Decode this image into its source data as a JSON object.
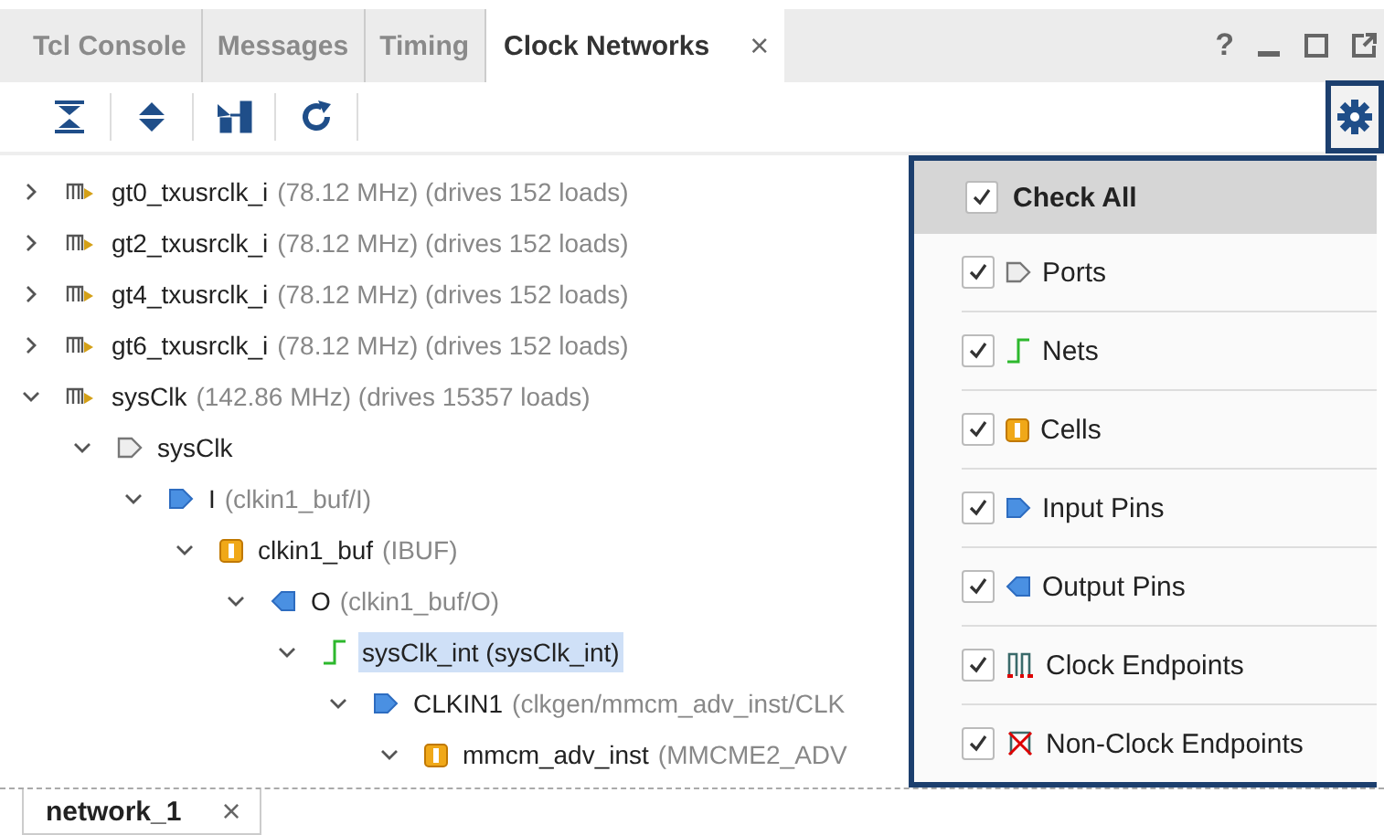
{
  "tabs": [
    {
      "label": "Tcl Console",
      "selected": false
    },
    {
      "label": "Messages",
      "selected": false
    },
    {
      "label": "Timing",
      "selected": false
    },
    {
      "label": "Clock Networks",
      "selected": true,
      "close": "×"
    }
  ],
  "window_controls": [
    "?"
  ],
  "tree": [
    {
      "kind": "clock",
      "name": "gt0_txusrclk_i",
      "detail": "(78.12 MHz) (drives 152 loads)",
      "expanded": false,
      "selected": false
    },
    {
      "kind": "clock",
      "name": "gt2_txusrclk_i",
      "detail": "(78.12 MHz) (drives 152 loads)",
      "expanded": false,
      "selected": false
    },
    {
      "kind": "clock",
      "name": "gt4_txusrclk_i",
      "detail": "(78.12 MHz) (drives 152 loads)",
      "expanded": false,
      "selected": false
    },
    {
      "kind": "clock",
      "name": "gt6_txusrclk_i",
      "detail": "(78.12 MHz) (drives 152 loads)",
      "expanded": false,
      "selected": false
    },
    {
      "kind": "clock",
      "name": "sysClk",
      "detail": "(142.86 MHz) (drives 15357 loads)",
      "expanded": true,
      "selected": false,
      "children": [
        {
          "kind": "port",
          "name": "sysClk",
          "expanded": true,
          "selected": false,
          "children": [
            {
              "kind": "input_pin",
              "name": "I",
              "detail": "(clkin1_buf/I)",
              "expanded": true,
              "selected": false,
              "children": [
                {
                  "kind": "cell",
                  "name": "clkin1_buf",
                  "detail": "(IBUF)",
                  "expanded": true,
                  "selected": false,
                  "children": [
                    {
                      "kind": "output_pin",
                      "name": "O",
                      "detail": "(clkin1_buf/O)",
                      "expanded": true,
                      "selected": false,
                      "children": [
                        {
                          "kind": "net",
                          "name": "sysClk_int (sysClk_int)",
                          "expanded": true,
                          "selected": true,
                          "children": [
                            {
                              "kind": "input_pin",
                              "name": "CLKIN1",
                              "detail": "(clkgen/mmcm_adv_inst/CLK",
                              "expanded": true,
                              "selected": false,
                              "children": [
                                {
                                  "kind": "cell",
                                  "name": "mmcm_adv_inst",
                                  "detail": "(MMCME2_ADV",
                                  "expanded": true,
                                  "selected": false
                                }
                              ]
                            }
                          ]
                        }
                      ]
                    }
                  ]
                }
              ]
            }
          ]
        }
      ]
    }
  ],
  "filter_menu": {
    "check_all": {
      "label": "Check All",
      "checked": true
    },
    "items": [
      {
        "kind": "port",
        "label": "Ports",
        "checked": true
      },
      {
        "kind": "net",
        "label": "Nets",
        "checked": true
      },
      {
        "kind": "cell",
        "label": "Cells",
        "checked": true
      },
      {
        "kind": "input_pin",
        "label": "Input Pins",
        "checked": true
      },
      {
        "kind": "output_pin",
        "label": "Output Pins",
        "checked": true
      },
      {
        "kind": "clock_endpoint",
        "label": "Clock Endpoints",
        "checked": true
      },
      {
        "kind": "nonclock_endpoint",
        "label": "Non-Clock Endpoints",
        "checked": true
      }
    ]
  },
  "bottom_tabs": [
    {
      "label": "network_1",
      "selected": true,
      "close": "×"
    }
  ]
}
